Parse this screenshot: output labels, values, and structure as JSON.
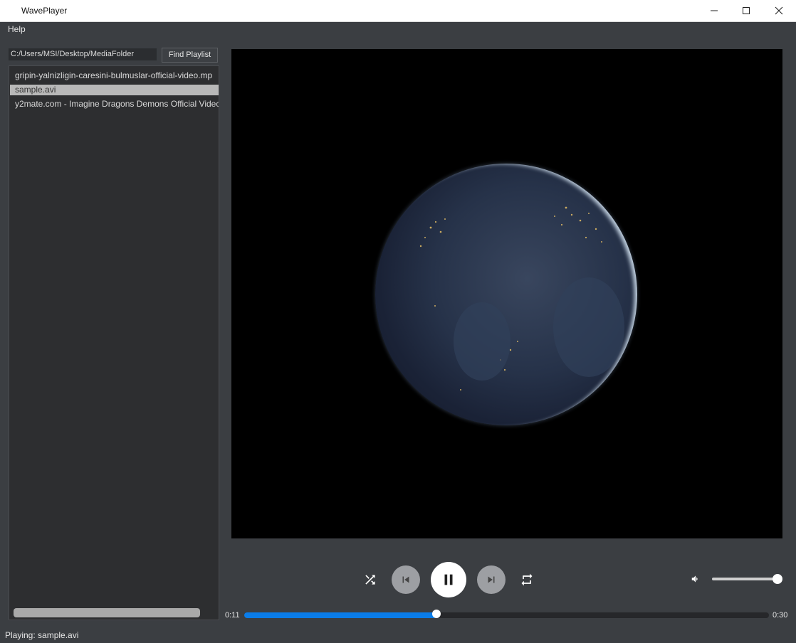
{
  "window": {
    "title": "WavePlayer"
  },
  "menu": {
    "help": "Help"
  },
  "sidebar": {
    "folder_path": "C:/Users/MSI/Desktop/MediaFolder",
    "find_button": "Find Playlist",
    "items": [
      {
        "label": "gripin-yalnizligin-caresini-bulmuslar-official-video.mp",
        "selected": false
      },
      {
        "label": "sample.avi",
        "selected": true
      },
      {
        "label": "y2mate.com - Imagine Dragons  Demons Official Video",
        "selected": false
      }
    ]
  },
  "controls": {
    "icons": [
      "shuffle-icon",
      "skip-previous-icon",
      "pause-icon",
      "skip-next-icon",
      "repeat-icon",
      "volume-icon"
    ],
    "volume_level": 1.0
  },
  "seek": {
    "current_time": "0:11",
    "total_time": "0:30",
    "progress": 0.3667
  },
  "status": {
    "text": "Playing: sample.avi"
  },
  "colors": {
    "accent": "#0a7ce8",
    "background": "#3b3e42"
  }
}
